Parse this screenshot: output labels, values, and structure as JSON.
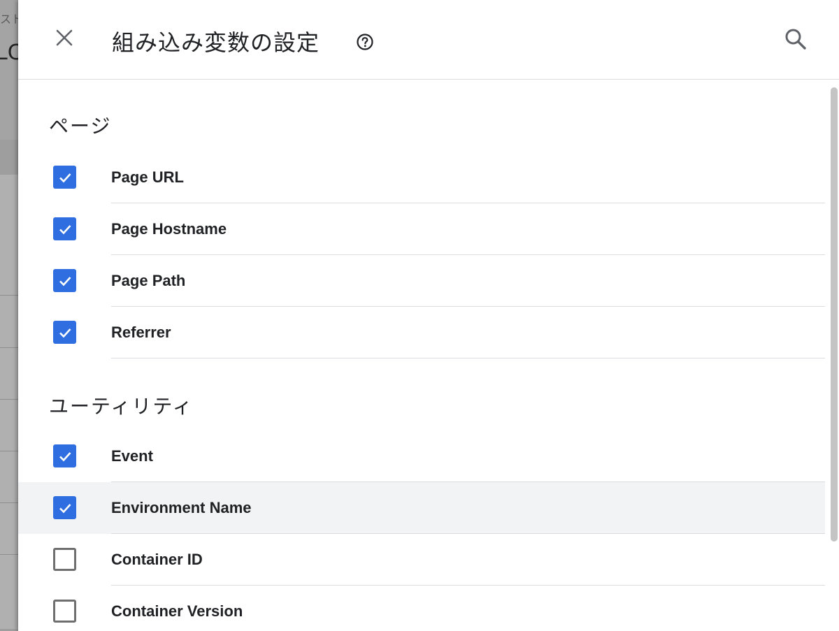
{
  "background": {
    "breadcrumb_fragment": "スト",
    "title_fragment": "LC"
  },
  "panel": {
    "title": "組み込み変数の設定",
    "close_icon": "close-icon",
    "help_icon": "help-circle-icon",
    "search_icon": "search-icon"
  },
  "sections": [
    {
      "title": "ページ",
      "items": [
        {
          "label": "Page URL",
          "checked": true
        },
        {
          "label": "Page Hostname",
          "checked": true
        },
        {
          "label": "Page Path",
          "checked": true
        },
        {
          "label": "Referrer",
          "checked": true
        }
      ]
    },
    {
      "title": "ユーティリティ",
      "items": [
        {
          "label": "Event",
          "checked": true
        },
        {
          "label": "Environment Name",
          "checked": true,
          "hovered": true
        },
        {
          "label": "Container ID",
          "checked": false
        },
        {
          "label": "Container Version",
          "checked": false
        }
      ]
    }
  ],
  "colors": {
    "checkbox_checked": "#2f6ee0",
    "checkbox_unchecked_border": "#6f6f6f",
    "row_hover": "#f1f3f4",
    "divider": "#dadce0",
    "text": "#202124"
  }
}
